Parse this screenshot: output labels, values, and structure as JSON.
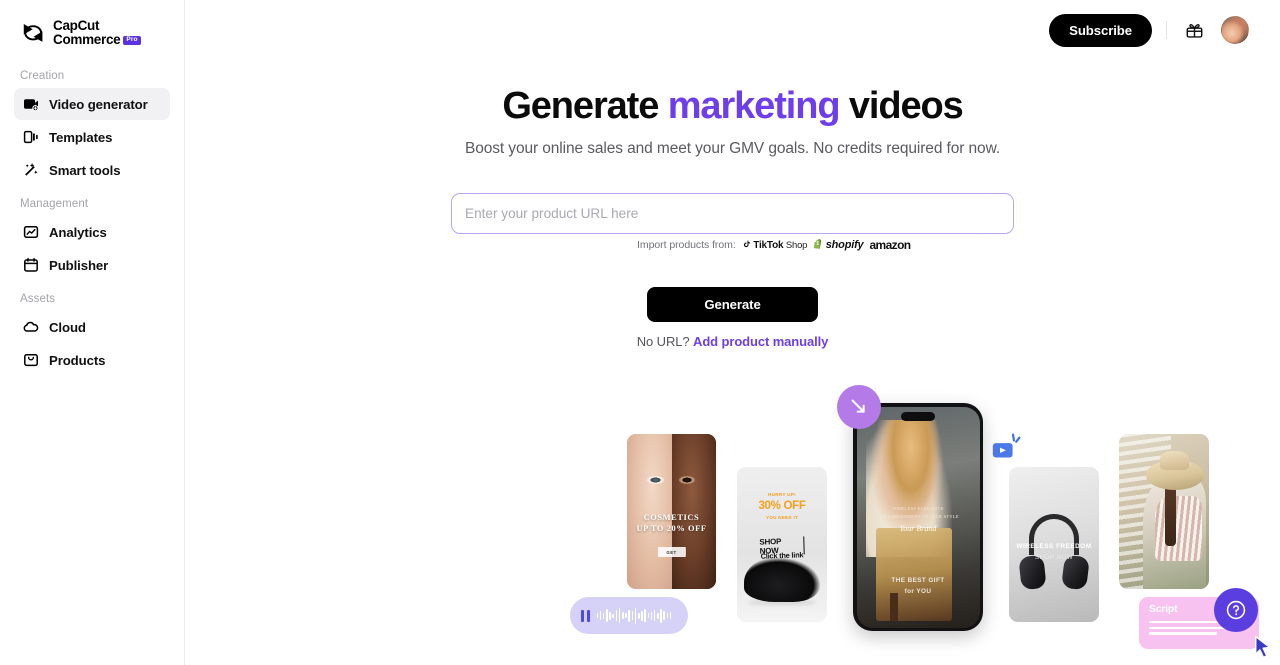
{
  "brand": {
    "name_line1": "CapCut",
    "name_line2": "Commerce",
    "badge": "Pro",
    "logo_icon": "capcut-logo-icon"
  },
  "colors": {
    "accent_purple": "#6d3eea",
    "brand_badge": "#5b32e0",
    "help_fab": "#5b3ee0",
    "sidebar_active_bg": "#f1f1f3",
    "input_border_focus": "#b9a6f2",
    "primary_button_bg": "#000000"
  },
  "sidebar": {
    "groups": [
      {
        "label": "Creation",
        "items": [
          {
            "label": "Video generator",
            "icon": "video-generator-icon",
            "active": true
          },
          {
            "label": "Templates",
            "icon": "templates-icon",
            "active": false
          },
          {
            "label": "Smart tools",
            "icon": "smart-tools-icon",
            "active": false
          }
        ]
      },
      {
        "label": "Management",
        "items": [
          {
            "label": "Analytics",
            "icon": "analytics-icon",
            "active": false
          },
          {
            "label": "Publisher",
            "icon": "publisher-icon",
            "active": false
          }
        ]
      },
      {
        "label": "Assets",
        "items": [
          {
            "label": "Cloud",
            "icon": "cloud-icon",
            "active": false
          },
          {
            "label": "Products",
            "icon": "products-icon",
            "active": false
          }
        ]
      }
    ]
  },
  "topbar": {
    "subscribe_label": "Subscribe",
    "gift_icon": "gift-icon",
    "avatar_icon": "user-avatar"
  },
  "hero": {
    "headline_part1": "Generate ",
    "headline_accent": "marketing",
    "headline_part2": " videos",
    "subheadline": "Boost your online sales and meet your GMV goals. No credits required for now."
  },
  "url_form": {
    "input_value": "",
    "input_placeholder": "Enter your product URL here",
    "import_label": "Import products from:",
    "sources": [
      {
        "name": "tiktok-shop",
        "bold": "TikTok",
        "light": "Shop"
      },
      {
        "name": "shopify",
        "text": "shopify"
      },
      {
        "name": "amazon",
        "text": "amazon"
      }
    ],
    "generate_label": "Generate",
    "no_url_text": "No URL?",
    "manual_link_label": "Add product manually"
  },
  "artwork": {
    "cosmetics_card": {
      "line1": "COSMETICS",
      "line2": "UP TO 20% OFF",
      "button": "GET"
    },
    "audio_pill": {
      "icon": "pause-icon",
      "waveform": "audio-waveform"
    },
    "shoe_card": {
      "hurry": "HURRY UP!",
      "discount": "30% OFF",
      "need": "YOU NEED IT",
      "shop_now": "SHOP NOW",
      "click_link": "Click the link"
    },
    "phone_card": {
      "line1": "TIMELESS ELEGANCE",
      "line2": "THE EMBODIMENT OF TRUE STYLE",
      "brand": "Your Brand",
      "bottom1": "THE BEST GIFT",
      "bottom2": "for YOU"
    },
    "headphones_card": {
      "title": "WIRELESS FREEDOM",
      "cta": "SHOP NOW"
    },
    "script_card": {
      "title": "Script"
    },
    "badges": {
      "resize_icon": "resize-arrow-icon",
      "play_icon": "play-video-icon",
      "cursor_icon": "cursor-pointer-icon"
    }
  },
  "help": {
    "label": "help-circle-icon"
  }
}
